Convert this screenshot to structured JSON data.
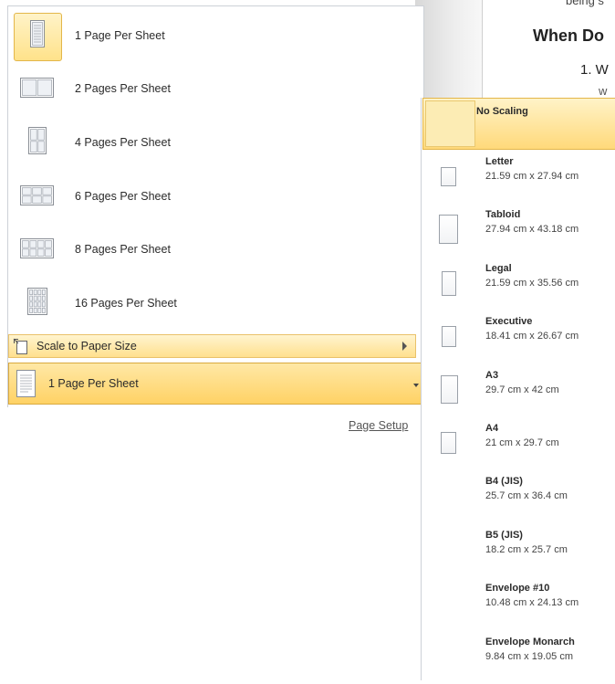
{
  "document": {
    "line1": "being s",
    "heading": "When Do",
    "list_item": "1.  W",
    "line2": "w"
  },
  "pages_per_sheet": {
    "items": [
      {
        "label": "1 Page Per Sheet",
        "icon": "one-page-per-sheet-icon"
      },
      {
        "label": "2 Pages Per Sheet",
        "icon": "two-pages-per-sheet-icon"
      },
      {
        "label": "4 Pages Per Sheet",
        "icon": "four-pages-per-sheet-icon"
      },
      {
        "label": "6 Pages Per Sheet",
        "icon": "six-pages-per-sheet-icon"
      },
      {
        "label": "8 Pages Per Sheet",
        "icon": "eight-pages-per-sheet-icon"
      },
      {
        "label": "16 Pages Per Sheet",
        "icon": "sixteen-pages-per-sheet-icon"
      }
    ],
    "selected_index": 0,
    "scale_to_paper_size": "Scale to Paper Size",
    "dropdown_value": "1 Page Per Sheet",
    "page_setup_link": "Page Setup"
  },
  "paper_sizes": {
    "no_scaling": "No Scaling",
    "items": [
      {
        "name": "Letter",
        "size": "21.59 cm x 27.94 cm",
        "icon": true
      },
      {
        "name": "Tabloid",
        "size": "27.94 cm x 43.18 cm",
        "icon": true
      },
      {
        "name": "Legal",
        "size": "21.59 cm x 35.56 cm",
        "icon": true
      },
      {
        "name": "Executive",
        "size": "18.41 cm x 26.67 cm",
        "icon": true
      },
      {
        "name": "A3",
        "size": "29.7 cm x 42 cm",
        "icon": true
      },
      {
        "name": "A4",
        "size": "21 cm x 29.7 cm",
        "icon": true
      },
      {
        "name": "B4 (JIS)",
        "size": "25.7 cm x 36.4 cm",
        "icon": false
      },
      {
        "name": "B5 (JIS)",
        "size": "18.2 cm x 25.7 cm",
        "icon": false
      },
      {
        "name": "Envelope #10",
        "size": "10.48 cm x 24.13 cm",
        "icon": false
      },
      {
        "name": "Envelope Monarch",
        "size": "9.84 cm x 19.05 cm",
        "icon": false
      }
    ]
  },
  "colors": {
    "highlight_top": "#fff3c8",
    "highlight_bottom": "#ffd97a",
    "highlight_border": "#e3b64a",
    "menu_border": "#cdd1d7"
  }
}
